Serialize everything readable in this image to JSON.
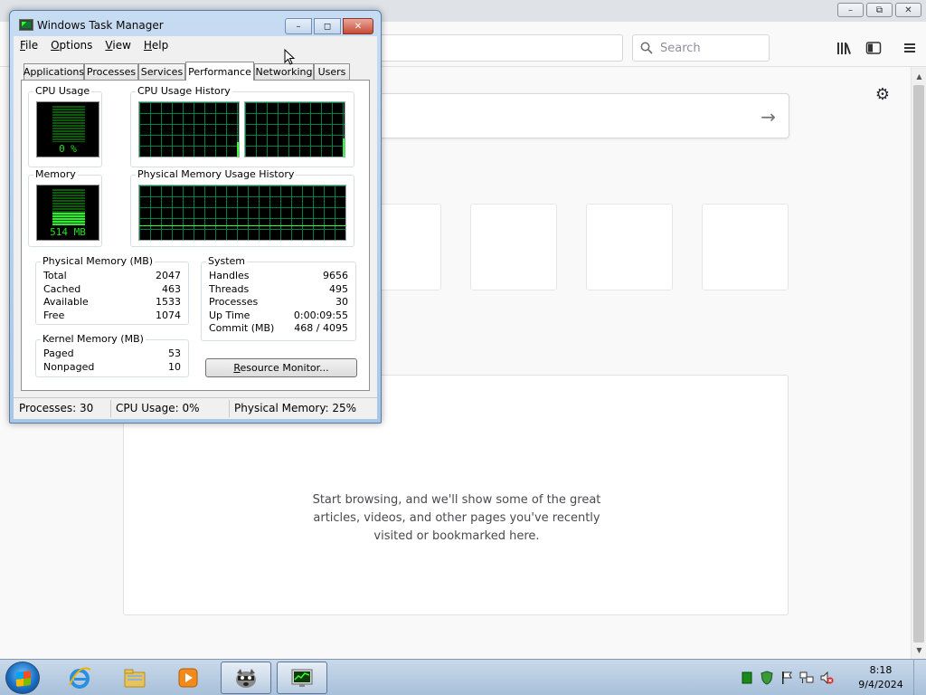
{
  "browser": {
    "search_placeholder": "Search",
    "highlights_empty_message": "Start browsing, and we'll show some of the great articles, videos, and other pages you've recently visited or bookmarked here."
  },
  "taskmgr": {
    "title": "Windows Task Manager",
    "menu": {
      "file": {
        "key": "F",
        "rest": "ile"
      },
      "options": {
        "key": "O",
        "rest": "ptions"
      },
      "view": {
        "key": "V",
        "rest": "iew"
      },
      "help": {
        "key": "H",
        "rest": "elp"
      }
    },
    "tabs": [
      "Applications",
      "Processes",
      "Services",
      "Performance",
      "Networking",
      "Users"
    ],
    "active_tab": "Performance",
    "cpu_usage": {
      "label": "CPU Usage",
      "value": "0 %"
    },
    "cpu_history": {
      "label": "CPU Usage History"
    },
    "memory": {
      "label": "Memory",
      "value": "514 MB"
    },
    "memory_history": {
      "label": "Physical Memory Usage History"
    },
    "physical_memory": {
      "label": "Physical Memory (MB)",
      "rows": [
        {
          "name": "Total",
          "value": "2047"
        },
        {
          "name": "Cached",
          "value": "463"
        },
        {
          "name": "Available",
          "value": "1533"
        },
        {
          "name": "Free",
          "value": "1074"
        }
      ]
    },
    "kernel_memory": {
      "label": "Kernel Memory (MB)",
      "rows": [
        {
          "name": "Paged",
          "value": "53"
        },
        {
          "name": "Nonpaged",
          "value": "10"
        }
      ]
    },
    "system": {
      "label": "System",
      "rows": [
        {
          "name": "Handles",
          "value": "9656"
        },
        {
          "name": "Threads",
          "value": "495"
        },
        {
          "name": "Processes",
          "value": "30"
        },
        {
          "name": "Up Time",
          "value": "0:00:09:55"
        },
        {
          "name": "Commit (MB)",
          "value": "468 / 4095"
        }
      ]
    },
    "resource_monitor_button": {
      "key": "R",
      "rest": "esource Monitor..."
    },
    "status": {
      "processes": "Processes: 30",
      "cpu": "CPU Usage: 0%",
      "memory": "Physical Memory: 25%"
    }
  },
  "taskbar": {
    "clock_time": "8:18",
    "clock_date": "9/4/2024"
  },
  "icons": {
    "browser_library": "library-icon",
    "browser_sidebar": "sidebar-icon",
    "browser_menu": "hamburger-menu-icon",
    "settings": "gear-icon",
    "go": "arrow-right-icon"
  },
  "colors": {
    "graph_green": "#33ff33",
    "graph_grid": "#008040",
    "taskbar": "#b9cde3",
    "close_button": "#c74a36"
  }
}
